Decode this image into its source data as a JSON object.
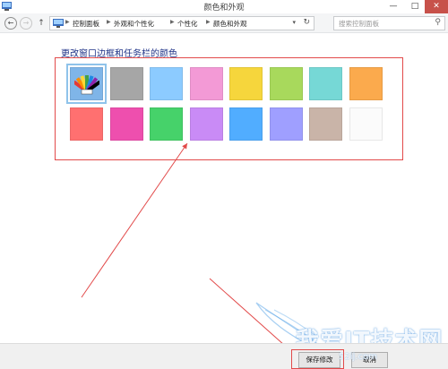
{
  "window": {
    "title": "颜色和外观"
  },
  "navigation": {
    "breadcrumbs": [
      "控制面板",
      "外观和个性化",
      "个性化",
      "颜色和外观"
    ],
    "search_placeholder": "搜索控制面板"
  },
  "main": {
    "heading": "更改窗口边框和任务栏的颜色",
    "swatches": [
      {
        "color": "#7fb5e8",
        "selected": true,
        "icon": "color-fan-icon"
      },
      {
        "color": "#a6a6a6"
      },
      {
        "color": "#8ccbff"
      },
      {
        "color": "#f39ad6"
      },
      {
        "color": "#f6d63c"
      },
      {
        "color": "#a8d95c"
      },
      {
        "color": "#76d8d6"
      },
      {
        "color": "#fbaa4d"
      },
      {
        "color": "#ff7070"
      },
      {
        "color": "#ee4fae"
      },
      {
        "color": "#46d26a"
      },
      {
        "color": "#c98bf6"
      },
      {
        "color": "#51adff"
      },
      {
        "color": "#9f9fff"
      },
      {
        "color": "#c9b4a8"
      },
      {
        "color": "#fbfbfb"
      }
    ]
  },
  "footer": {
    "save_label": "保存修改",
    "cancel_label": "取消"
  },
  "watermark": {
    "text": "我爱IT技术网",
    "url": "52ij.com"
  },
  "colors": {
    "annotation": "#e24a4a",
    "heading": "#1e3287"
  }
}
